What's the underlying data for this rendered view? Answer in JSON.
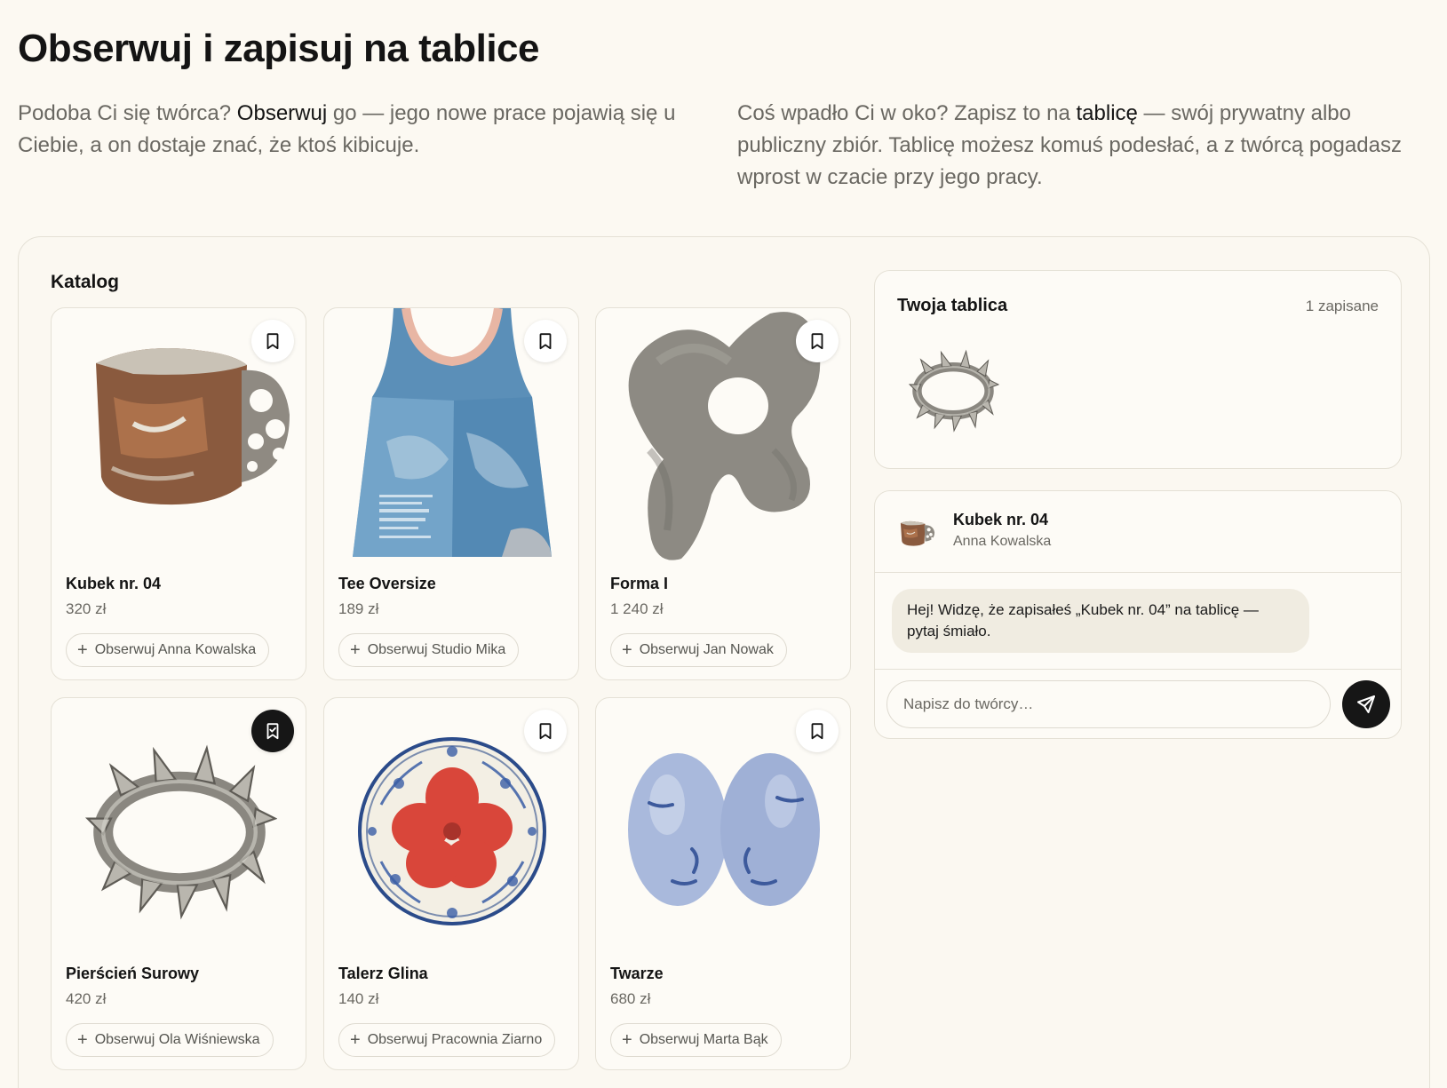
{
  "hero": {
    "title": "Obserwuj i zapisuj na tablice",
    "left": {
      "before": "Podoba Ci się twórca? ",
      "highlight": "Obserwuj",
      "after": " go — jego nowe prace pojawią się u Ciebie, a on dostaje znać, że ktoś kibicuje."
    },
    "right": {
      "before": "Coś wpadło Ci w oko? Zapisz to na ",
      "highlight": "tablicę",
      "after": " — swój prywatny albo publiczny zbiór. Tablicę możesz komuś podesłać, a z twórcą pogadasz wprost w czacie przy jego pracy."
    }
  },
  "catalog": {
    "label": "Katalog",
    "products": [
      {
        "name": "Kubek nr. 04",
        "price": "320 zł",
        "follow": "Obserwuj Anna Kowalska",
        "saved": false,
        "icon": "mug-image"
      },
      {
        "name": "Tee Oversize",
        "price": "189 zł",
        "follow": "Obserwuj Studio Mika",
        "saved": false,
        "icon": "tank-top-image"
      },
      {
        "name": "Forma I",
        "price": "1 240 zł",
        "follow": "Obserwuj Jan Nowak",
        "saved": false,
        "icon": "stone-sculpture-image"
      },
      {
        "name": "Pierścień Surowy",
        "price": "420 zł",
        "follow": "Obserwuj Ola Wiśniewska",
        "saved": true,
        "icon": "spiked-ring-image"
      },
      {
        "name": "Talerz Glina",
        "price": "140 zł",
        "follow": "Obserwuj Pracownia Ziarno",
        "saved": false,
        "icon": "floral-plate-image"
      },
      {
        "name": "Twarze",
        "price": "680 zł",
        "follow": "Obserwuj Marta Bąk",
        "saved": false,
        "icon": "ceramic-faces-image"
      }
    ]
  },
  "board": {
    "title": "Twoja tablica",
    "count": "1 zapisane"
  },
  "chat": {
    "product_name": "Kubek nr. 04",
    "maker": "Anna Kowalska",
    "message": "Hej! Widzę, że zapisałeś „Kubek nr. 04” na tablicę — pytaj śmiało.",
    "input_placeholder": "Napisz do twórcy…"
  },
  "colors": {
    "background": "#fcf9f2",
    "card": "#fdfbf6",
    "border": "#e5e1d6",
    "text_dark": "#141414",
    "text_muted": "#6a6862",
    "accent_dark": "#161616",
    "bubble": "#f0ece1"
  }
}
